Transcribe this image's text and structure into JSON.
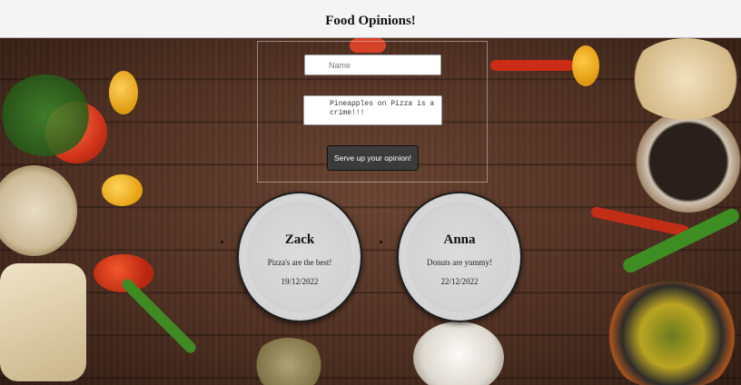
{
  "header": {
    "title": "Food Opinions!"
  },
  "form": {
    "name_placeholder": "Name",
    "opinion_value": "Pineapples on Pizza is a crime!!!",
    "submit_label": "Serve up your opinion!"
  },
  "opinions": [
    {
      "name": "Zack",
      "opinion": "Pizza's are the best!",
      "date": "19/12/2022"
    },
    {
      "name": "Anna",
      "opinion": "Donuts are yummy!",
      "date": "22/12/2022"
    }
  ],
  "colors": {
    "board": "#4e2f21",
    "button": "#3b3b3b",
    "plate": "#d4d4d4"
  },
  "background": {
    "image": "wooden-table-with-food-ingredients"
  }
}
